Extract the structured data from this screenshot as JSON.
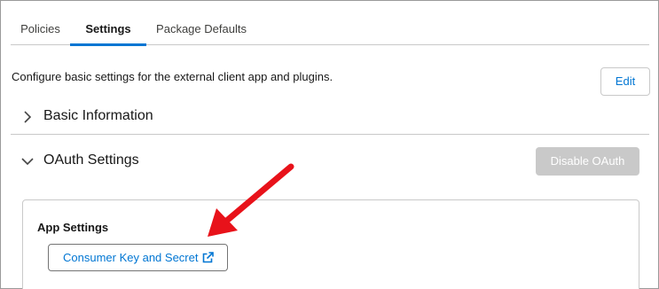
{
  "tabs": [
    {
      "label": "Policies",
      "active": false
    },
    {
      "label": "Settings",
      "active": true
    },
    {
      "label": "Package Defaults",
      "active": false
    }
  ],
  "description": "Configure basic settings for the external client app and plugins.",
  "edit_label": "Edit",
  "sections": {
    "basic_info": {
      "title": "Basic Information",
      "expanded": false
    },
    "oauth": {
      "title": "OAuth Settings",
      "expanded": true,
      "disable_label": "Disable OAuth",
      "disable_enabled": false
    }
  },
  "app_settings": {
    "title": "App Settings",
    "consumer_button_label": "Consumer Key and Secret"
  },
  "colors": {
    "accent": "#0176d3",
    "annotation_arrow": "#e8121a",
    "disabled_button": "#c9c9c9"
  },
  "icons": [
    "chevron-right-icon",
    "chevron-down-icon",
    "external-link-icon"
  ]
}
